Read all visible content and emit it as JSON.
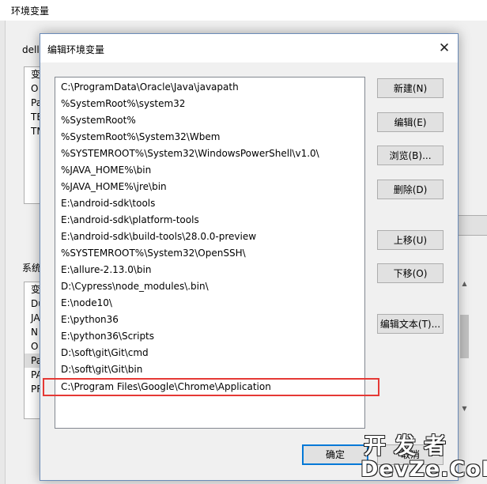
{
  "parent_window": {
    "title": "环境变量",
    "user_group_label": "dell",
    "user_vars": [
      "变",
      "O",
      "Pa",
      "TE",
      "TM"
    ],
    "system_group_label": "系统",
    "system_vars": [
      "变",
      "Du",
      "JA",
      "N",
      "O",
      "Pa",
      "PA",
      "PR"
    ],
    "selected_system_index": 5
  },
  "dialog": {
    "title": "编辑环境变量",
    "close_glyph": "✕",
    "paths": [
      "C:\\ProgramData\\Oracle\\Java\\javapath",
      "%SystemRoot%\\system32",
      "%SystemRoot%",
      "%SystemRoot%\\System32\\Wbem",
      "%SYSTEMROOT%\\System32\\WindowsPowerShell\\v1.0\\",
      "%JAVA_HOME%\\bin",
      "%JAVA_HOME%\\jre\\bin",
      "E:\\android-sdk\\tools",
      "E:\\android-sdk\\platform-tools",
      "E:\\android-sdk\\build-tools\\28.0.0-preview",
      "%SYSTEMROOT%\\System32\\OpenSSH\\",
      "E:\\allure-2.13.0\\bin",
      "D:\\Cypress\\node_modules\\.bin\\",
      "E:\\node10\\",
      "E:\\python36",
      "E:\\python36\\Scripts",
      "D:\\soft\\git\\Git\\cmd",
      "D:\\soft\\git\\Git\\bin",
      "C:\\Program Files\\Google\\Chrome\\Application"
    ],
    "highlighted_index": 18,
    "highlight_color": "#e53935",
    "buttons": {
      "new": "新建(N)",
      "edit": "编辑(E)",
      "browse": "浏览(B)...",
      "delete": "删除(D)",
      "move_up": "上移(U)",
      "move_down": "下移(O)",
      "edit_text": "编辑文本(T)..."
    },
    "ok_label": "确定",
    "cancel_label": "取消"
  },
  "watermark": {
    "cn": "开发者",
    "en": "DevZe.CoM"
  }
}
